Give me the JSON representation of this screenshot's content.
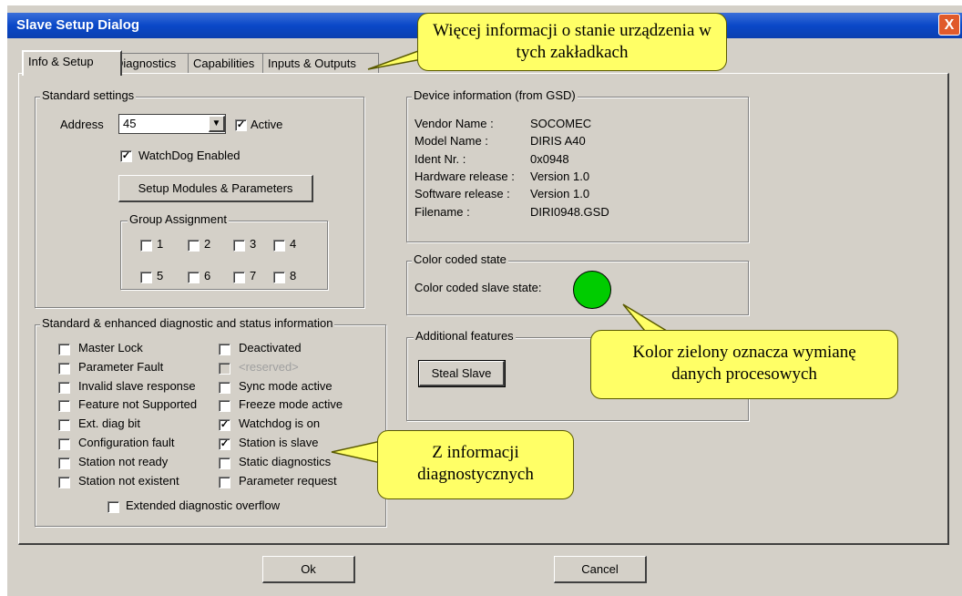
{
  "window": {
    "title": "Slave Setup Dialog",
    "close_label": "X"
  },
  "tabs": [
    "Info & Setup",
    "Diagnostics",
    "Capabilities",
    "Inputs & Outputs"
  ],
  "standard_settings": {
    "title": "Standard settings",
    "address_label": "Address",
    "address_value": "45",
    "active_label": "Active",
    "watchdog_label": "WatchDog Enabled",
    "setup_button": "Setup Modules & Parameters",
    "group_assignment": {
      "title": "Group Assignment",
      "groups": [
        "1",
        "2",
        "3",
        "4",
        "5",
        "6",
        "7",
        "8"
      ]
    }
  },
  "diagnostics": {
    "title": "Standard & enhanced diagnostic and status information",
    "left": [
      "Master Lock",
      "Parameter Fault",
      "Invalid slave response",
      "Feature not Supported",
      "Ext. diag bit",
      "Configuration fault",
      "Station not ready",
      "Station not existent"
    ],
    "right": [
      "Deactivated",
      "<reserved>",
      "Sync mode active",
      "Freeze mode active",
      "Watchdog is on",
      "Station is slave",
      "Static diagnostics",
      "Parameter request"
    ],
    "right_checked": [
      false,
      false,
      false,
      false,
      true,
      true,
      false,
      false
    ],
    "overflow": "Extended diagnostic overflow"
  },
  "device_info": {
    "title": "Device information (from GSD)",
    "rows": [
      {
        "label": "Vendor Name :",
        "value": "SOCOMEC"
      },
      {
        "label": "Model Name :",
        "value": "DIRIS A40"
      },
      {
        "label": "Ident Nr. :",
        "value": "0x0948"
      },
      {
        "label": "Hardware release :",
        "value": "Version 1.0"
      },
      {
        "label": "Software release :",
        "value": "Version 1.0"
      },
      {
        "label": "Filename :",
        "value": "DIRI0948.GSD"
      }
    ]
  },
  "color_state": {
    "title": "Color coded state",
    "label": "Color coded slave state:",
    "color": "#00cc00"
  },
  "additional": {
    "title": "Additional features",
    "steal_button": "Steal Slave"
  },
  "footer": {
    "ok": "Ok",
    "cancel": "Cancel"
  },
  "callouts": {
    "tabs": "Więcej informacji o stanie urządzenia w tych zakładkach",
    "green": "Kolor zielony oznacza wymianę danych procesowych",
    "diag": "Z informacji diagnostycznych"
  }
}
